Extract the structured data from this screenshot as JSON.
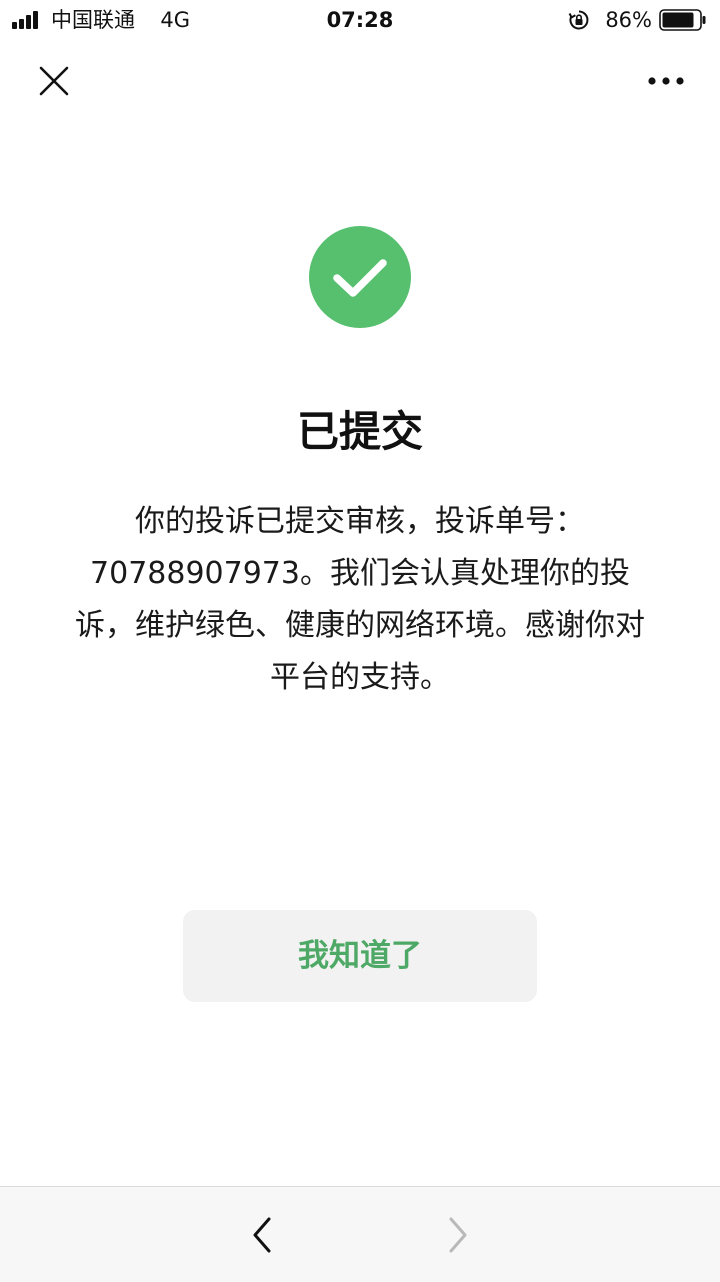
{
  "status_bar": {
    "carrier": "中国联通",
    "network": "4G",
    "time": "07:28",
    "battery_percent": "86%",
    "battery_level": 0.86
  },
  "nav": {
    "close_icon": "close-icon",
    "more_icon": "more-icon"
  },
  "result": {
    "icon": "check-circle-icon",
    "icon_color": "#56c06f",
    "title": "已提交",
    "message": "你的投诉已提交审核，投诉单号：70788907973。我们会认真处理你的投诉，维护绿色、健康的网络环境。感谢你对平台的支持。"
  },
  "actions": {
    "acknowledge_label": "我知道了",
    "acknowledge_color": "#4ea866"
  },
  "toolbar": {
    "back_icon": "chevron-left-icon",
    "forward_icon": "chevron-right-icon"
  }
}
